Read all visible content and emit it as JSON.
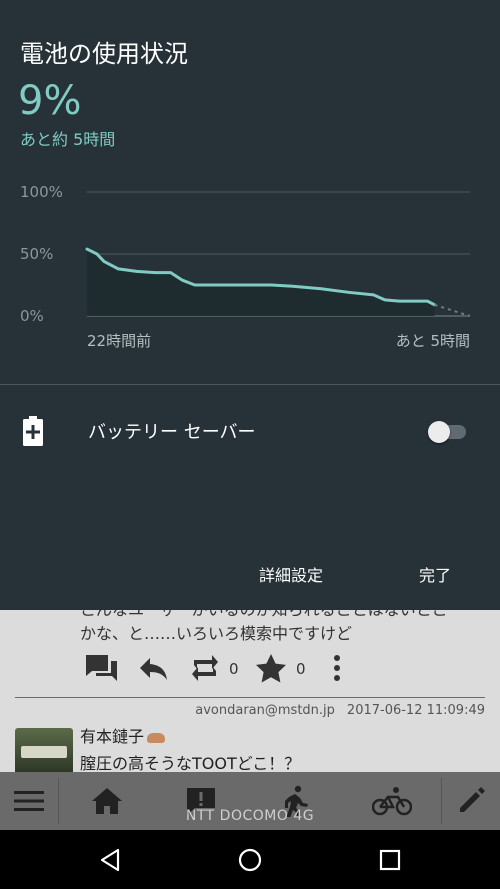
{
  "panel": {
    "title": "電池の使用状況",
    "battery_percent": "9%",
    "time_remaining": "あと約 5時間",
    "battery_saver_label": "バッテリー セーバー",
    "battery_saver_enabled": false,
    "advanced_settings_label": "詳細設定",
    "done_label": "完了"
  },
  "colors": {
    "panel_bg": "#263238",
    "accent": "#80cbc4"
  },
  "chart_data": {
    "type": "area",
    "y_ticks": [
      "100%",
      "50%",
      "0%"
    ],
    "ylim": [
      0,
      100
    ],
    "x_labels": {
      "start": "22時間前",
      "end": "あと 5時間"
    },
    "xlim": [
      -22,
      5
    ],
    "x_unit": "hours",
    "history": [
      {
        "x": -22.0,
        "y": 54
      },
      {
        "x": -21.3,
        "y": 50
      },
      {
        "x": -20.8,
        "y": 44
      },
      {
        "x": -19.8,
        "y": 38
      },
      {
        "x": -18.5,
        "y": 36
      },
      {
        "x": -17.2,
        "y": 35
      },
      {
        "x": -16.1,
        "y": 35
      },
      {
        "x": -15.3,
        "y": 29
      },
      {
        "x": -14.4,
        "y": 25
      },
      {
        "x": -12.0,
        "y": 25
      },
      {
        "x": -9.0,
        "y": 25
      },
      {
        "x": -7.5,
        "y": 24
      },
      {
        "x": -5.5,
        "y": 22
      },
      {
        "x": -3.5,
        "y": 19
      },
      {
        "x": -1.8,
        "y": 17
      },
      {
        "x": -1.0,
        "y": 13
      },
      {
        "x": 0.0,
        "y": 12
      },
      {
        "x": 2.0,
        "y": 12
      },
      {
        "x": 2.5,
        "y": 9
      }
    ],
    "projection": [
      {
        "x": 2.5,
        "y": 9
      },
      {
        "x": 5.0,
        "y": 0
      }
    ],
    "grid": true
  },
  "background_app": {
    "post_line_1": "こんなユーザーがいるのか知られることはないとこ",
    "post_line_2": "かな、と……いろいろ模索中ですけど",
    "boost_count": "0",
    "favourite_count": "0",
    "meta_account": "avondaran@mstdn.jp",
    "meta_timestamp": "2017-06-12 11:09:49",
    "author_name": "有本鏈子",
    "toot_text": "膣圧の高そうなTOOTどこ！？",
    "carrier": "NTT DOCOMO 4G",
    "nav_icons": [
      "menu-icon",
      "home-icon",
      "notifications-icon",
      "local-timeline-icon",
      "federated-timeline-icon",
      "compose-icon"
    ]
  }
}
